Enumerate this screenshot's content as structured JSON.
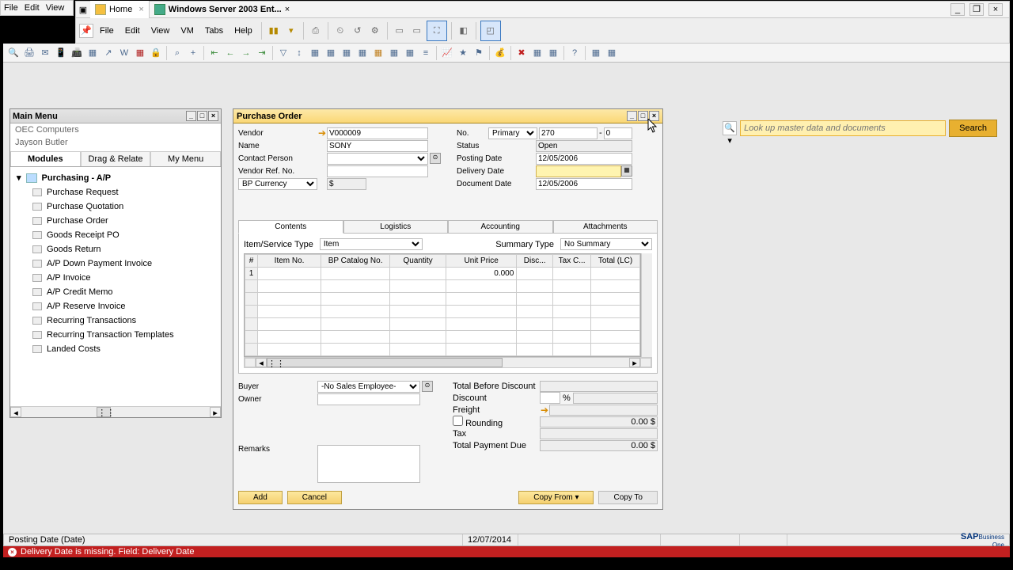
{
  "outer_menu": {
    "file": "File",
    "edit": "Edit",
    "view": "View"
  },
  "vm": {
    "home_tab": "Home",
    "active_tab": "Windows Server 2003 Ent...",
    "menubar": {
      "file": "File",
      "edit": "Edit",
      "view": "View",
      "vm": "VM",
      "tabs": "Tabs",
      "help": "Help"
    }
  },
  "main_menu": {
    "title": "Main Menu",
    "company": "OEC Computers",
    "user": "Jayson Butler",
    "tabs": {
      "modules": "Modules",
      "drag": "Drag & Relate",
      "mymenu": "My Menu"
    },
    "section": "Purchasing - A/P",
    "items": [
      "Purchase Request",
      "Purchase Quotation",
      "Purchase Order",
      "Goods Receipt PO",
      "Goods Return",
      "A/P Down Payment Invoice",
      "A/P Invoice",
      "A/P Credit Memo",
      "A/P Reserve Invoice",
      "Recurring Transactions",
      "Recurring Transaction Templates",
      "Landed Costs"
    ]
  },
  "po": {
    "title": "Purchase Order",
    "fields": {
      "vendor_lbl": "Vendor",
      "vendor_val": "V000009",
      "name_lbl": "Name",
      "name_val": "SONY",
      "contact_lbl": "Contact Person",
      "contact_val": "",
      "vref_lbl": "Vendor Ref. No.",
      "vref_val": "",
      "currency_lbl": "BP Currency",
      "currency_sym": "$",
      "no_lbl": "No.",
      "no_type": "Primary",
      "no_val": "270",
      "no_sub": "0",
      "status_lbl": "Status",
      "status_val": "Open",
      "posting_lbl": "Posting Date",
      "posting_val": "12/05/2006",
      "delivery_lbl": "Delivery Date",
      "delivery_val": "",
      "document_lbl": "Document Date",
      "document_val": "12/05/2006"
    },
    "tabs": {
      "contents": "Contents",
      "logistics": "Logistics",
      "accounting": "Accounting",
      "attachments": "Attachments"
    },
    "grid": {
      "itemservice_lbl": "Item/Service Type",
      "itemservice_val": "Item",
      "summary_lbl": "Summary Type",
      "summary_val": "No Summary",
      "headers": {
        "num": "#",
        "itemno": "Item No.",
        "cat": "BP Catalog No.",
        "qty": "Quantity",
        "price": "Unit Price",
        "disc": "Disc...",
        "tax": "Tax C...",
        "total": "Total (LC)"
      },
      "row1_price": "0.000"
    },
    "lower": {
      "buyer_lbl": "Buyer",
      "buyer_val": "-No Sales Employee-",
      "owner_lbl": "Owner",
      "owner_val": "",
      "remarks_lbl": "Remarks",
      "remarks_val": "",
      "t_before": "Total Before Discount",
      "t_discount": "Discount",
      "t_discount_pct": "%",
      "t_freight": "Freight",
      "t_rounding": "Rounding",
      "t_rounding_val": "0.00 $",
      "t_tax": "Tax",
      "t_due": "Total Payment Due",
      "t_due_val": "0.00 $"
    },
    "buttons": {
      "add": "Add",
      "cancel": "Cancel",
      "copyfrom": "Copy From",
      "copyto": "Copy To"
    }
  },
  "search": {
    "placeholder": "Look up master data and documents",
    "button": "Search"
  },
  "status": {
    "field": "Posting Date (Date)",
    "date": "12/07/2014"
  },
  "error": {
    "msg": "Delivery Date is missing.  Field: Delivery Date"
  }
}
